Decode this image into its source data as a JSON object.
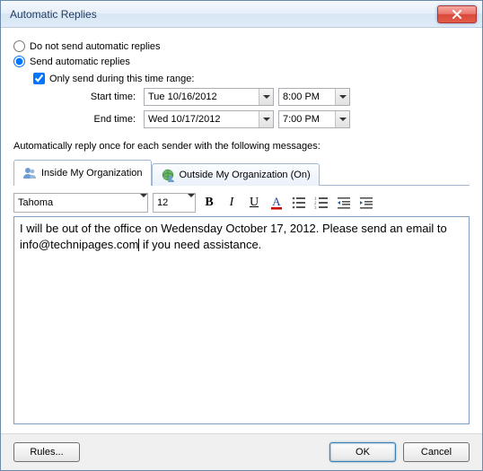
{
  "window": {
    "title": "Automatic Replies"
  },
  "options": {
    "dont_send_label": "Do not send automatic replies",
    "send_label": "Send automatic replies",
    "only_during_label": "Only send during this time range:"
  },
  "time": {
    "start_label": "Start time:",
    "start_date": "Tue 10/16/2012",
    "start_time": "8:00 PM",
    "end_label": "End time:",
    "end_date": "Wed 10/17/2012",
    "end_time": "7:00 PM"
  },
  "section_label": "Automatically reply once for each sender with the following messages:",
  "tabs": {
    "inside": "Inside My Organization",
    "outside": "Outside My Organization (On)"
  },
  "toolbar": {
    "font": "Tahoma",
    "size": "12",
    "bold": "B",
    "italic": "I",
    "underline": "U",
    "color": "A"
  },
  "message": {
    "part1": "I will be out of the office on Wedensday October 17, 2012. Please send an email to info@technipages.com",
    "part2": " if you need assistance."
  },
  "buttons": {
    "rules": "Rules...",
    "ok": "OK",
    "cancel": "Cancel"
  }
}
